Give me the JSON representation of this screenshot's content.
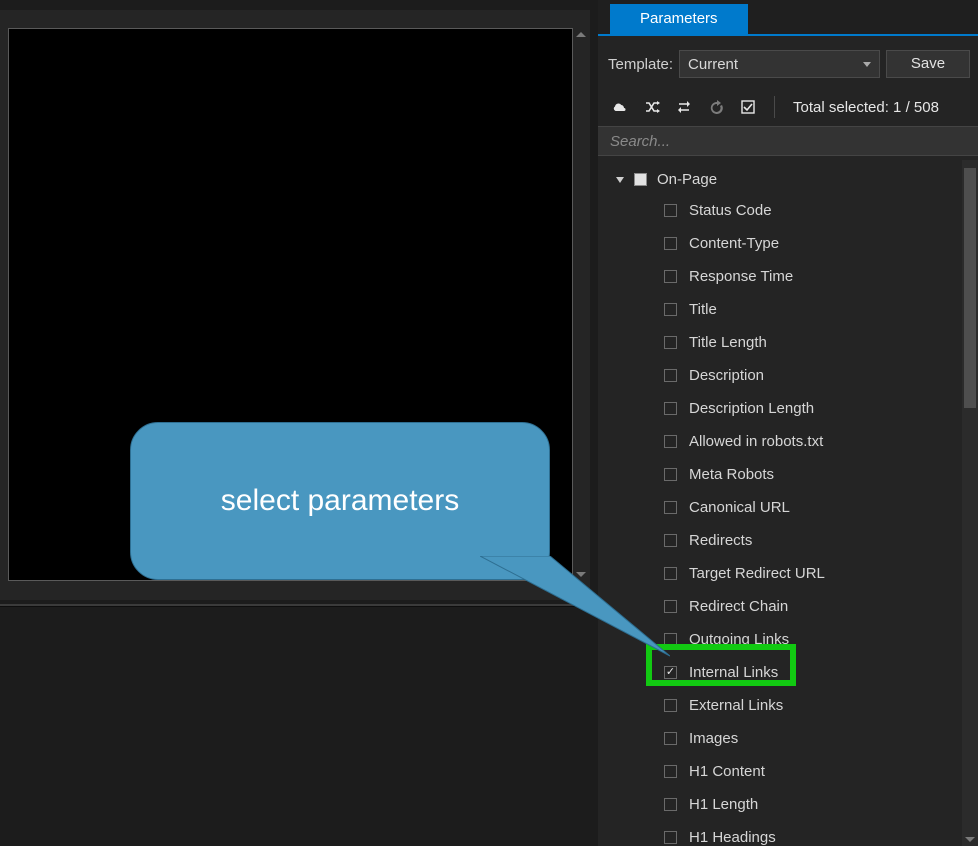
{
  "tabs": {
    "parameters": "Parameters"
  },
  "template": {
    "label": "Template:",
    "selected": "Current",
    "save_label": "Save"
  },
  "toolbar": {
    "total_text": "Total selected: 1 / 508"
  },
  "search": {
    "placeholder": "Search..."
  },
  "tree": {
    "group": "On-Page",
    "items": [
      {
        "label": "Status Code",
        "checked": false
      },
      {
        "label": "Content-Type",
        "checked": false
      },
      {
        "label": "Response Time",
        "checked": false
      },
      {
        "label": "Title",
        "checked": false
      },
      {
        "label": "Title Length",
        "checked": false
      },
      {
        "label": "Description",
        "checked": false
      },
      {
        "label": "Description Length",
        "checked": false
      },
      {
        "label": "Allowed in robots.txt",
        "checked": false
      },
      {
        "label": "Meta Robots",
        "checked": false
      },
      {
        "label": "Canonical URL",
        "checked": false
      },
      {
        "label": "Redirects",
        "checked": false
      },
      {
        "label": "Target Redirect URL",
        "checked": false
      },
      {
        "label": "Redirect Chain",
        "checked": false
      },
      {
        "label": "Outgoing Links",
        "checked": false
      },
      {
        "label": "Internal Links",
        "checked": true,
        "highlight": true
      },
      {
        "label": "External Links",
        "checked": false
      },
      {
        "label": "Images",
        "checked": false
      },
      {
        "label": "H1 Content",
        "checked": false
      },
      {
        "label": "H1 Length",
        "checked": false
      },
      {
        "label": "H1 Headings",
        "checked": false
      }
    ]
  },
  "callout": {
    "text": "select parameters"
  }
}
